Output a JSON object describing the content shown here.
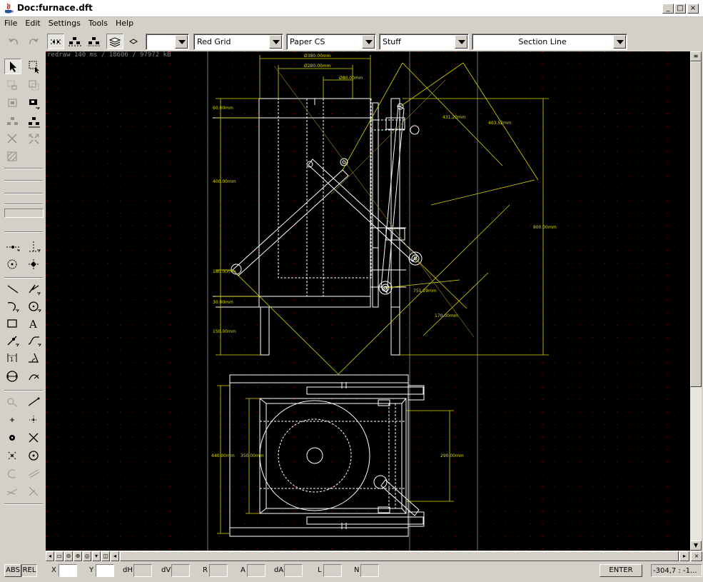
{
  "window": {
    "title": "Doc:furnace.dft"
  },
  "menu": {
    "file": "File",
    "edit": "Edit",
    "settings": "Settings",
    "tools": "Tools",
    "help": "Help"
  },
  "toolbar": {
    "layer_combo": "",
    "grid_combo": "Red Grid",
    "cs_combo": "Paper CS",
    "stuff_combo": "Stuff",
    "linetype_combo": "Section Line"
  },
  "canvas": {
    "info": "redraw 140 ms / 18606 / 97972 kB",
    "dims": {
      "d380": "Ø380.00mm",
      "d280": "Ø280.00mm",
      "d80": "Ø80.00mm",
      "h60": "60.00mm",
      "h400": "400.00mm",
      "h180": "180.00mm",
      "h30": "30.00mm",
      "h150": "150.00mm",
      "a431": "431.20mm",
      "a403": "403.52mm",
      "v800": "800.00mm",
      "a751": "751.29mm",
      "a170": "170.00mm",
      "h440": "440.00mm",
      "h350": "350.00mm",
      "h290": "290.00mm"
    },
    "colors": {
      "background": "#000000",
      "geometry": "#ffffff",
      "dimension": "#d8d800",
      "grid": "#c00000"
    }
  },
  "status": {
    "abs": "ABS",
    "rel": "REL",
    "x": "X",
    "y": "Y",
    "dh": "dH",
    "dv": "dV",
    "r": "R",
    "a": "A",
    "da": "dA",
    "l": "L",
    "n": "N",
    "enter": "ENTER",
    "coords": "-304,7 : -1..."
  }
}
